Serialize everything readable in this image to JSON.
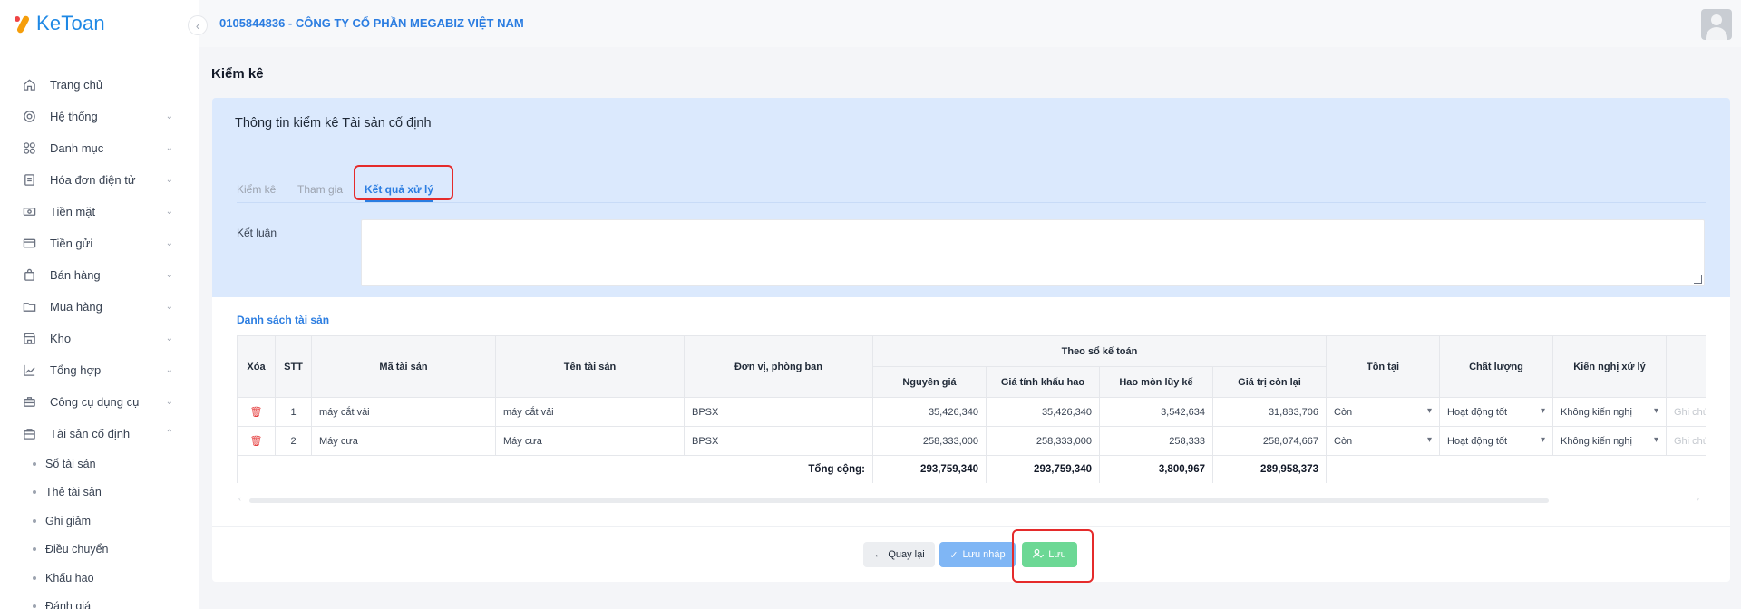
{
  "app": {
    "logo_text": "KeToan"
  },
  "header": {
    "company": "0105844836 - CÔNG TY CỔ PHẦN MEGABIZ VIỆT NAM"
  },
  "sidebar": {
    "items": [
      {
        "label": "Trang chủ",
        "icon": "home-icon",
        "chevron": ""
      },
      {
        "label": "Hệ thống",
        "icon": "gear-icon",
        "chevron": "⌄"
      },
      {
        "label": "Danh mục",
        "icon": "grid-icon",
        "chevron": "⌄"
      },
      {
        "label": "Hóa đơn điện tử",
        "icon": "invoice-icon",
        "chevron": "⌄"
      },
      {
        "label": "Tiền mặt",
        "icon": "cash-icon",
        "chevron": "⌄"
      },
      {
        "label": "Tiền gửi",
        "icon": "card-icon",
        "chevron": "⌄"
      },
      {
        "label": "Bán hàng",
        "icon": "bag-icon",
        "chevron": "⌄"
      },
      {
        "label": "Mua hàng",
        "icon": "folder-icon",
        "chevron": "⌄"
      },
      {
        "label": "Kho",
        "icon": "warehouse-icon",
        "chevron": "⌄"
      },
      {
        "label": "Tổng hợp",
        "icon": "chart-icon",
        "chevron": "⌄"
      },
      {
        "label": "Công cụ dụng cụ",
        "icon": "tools-icon",
        "chevron": "⌄"
      },
      {
        "label": "Tài sản cố định",
        "icon": "briefcase-icon",
        "chevron": "⌃"
      }
    ],
    "subitems": [
      "Sổ tài sản",
      "Thẻ tài sản",
      "Ghi giảm",
      "Điều chuyển",
      "Khấu hao",
      "Đánh giá"
    ]
  },
  "page": {
    "title": "Kiểm kê"
  },
  "card": {
    "title": "Thông tin kiểm kê Tài sản cố định",
    "tabs": [
      "Kiểm kê",
      "Tham gia",
      "Kết quả xử lý"
    ],
    "ket_luan_label": "Kết luận",
    "ket_luan_value": ""
  },
  "assets": {
    "section_title": "Danh sách tài sản",
    "headers": {
      "xoa": "Xóa",
      "stt": "STT",
      "ma": "Mã tài sản",
      "ten": "Tên tài sản",
      "don_vi": "Đơn vị, phòng ban",
      "group": "Theo sổ kế toán",
      "nguyen_gia": "Nguyên giá",
      "gia_tinh_kh": "Giá tính khấu hao",
      "hao_mon": "Hao mòn lũy kế",
      "gia_tri_con_lai": "Giá trị còn lại",
      "ton_tai": "Tồn tại",
      "chat_luong": "Chất lượng",
      "kien_nghi": "Kiến nghị xử lý"
    },
    "rows": [
      {
        "stt": "1",
        "ma": "máy cắt vải",
        "ten": "máy cắt vải",
        "don_vi": "BPSX",
        "nguyen_gia": "35,426,340",
        "gia_tinh_kh": "35,426,340",
        "hao_mon": "3,542,634",
        "con_lai": "31,883,706",
        "ton_tai": "Còn",
        "chat_luong": "Hoạt động tốt",
        "kien_nghi": "Không kiến nghị",
        "ghi_chu_placeholder": "Ghi chú"
      },
      {
        "stt": "2",
        "ma": "Máy cưa",
        "ten": "Máy cưa",
        "don_vi": "BPSX",
        "nguyen_gia": "258,333,000",
        "gia_tinh_kh": "258,333,000",
        "hao_mon": "258,333",
        "con_lai": "258,074,667",
        "ton_tai": "Còn",
        "chat_luong": "Hoạt động tốt",
        "kien_nghi": "Không kiến nghị",
        "ghi_chu_placeholder": "Ghi chú"
      }
    ],
    "totals": {
      "label": "Tổng cộng:",
      "nguyen_gia": "293,759,340",
      "gia_tinh_kh": "293,759,340",
      "hao_mon": "3,800,967",
      "con_lai": "289,958,373"
    }
  },
  "actions": {
    "back": "Quay lại",
    "draft": "Lưu nháp",
    "save": "Lưu"
  },
  "colors": {
    "accent": "#2b7de1",
    "save": "#6cd895",
    "draft": "#7fb6f5",
    "annotation": "#e52b2b",
    "card_header": "#dbe9fd"
  }
}
